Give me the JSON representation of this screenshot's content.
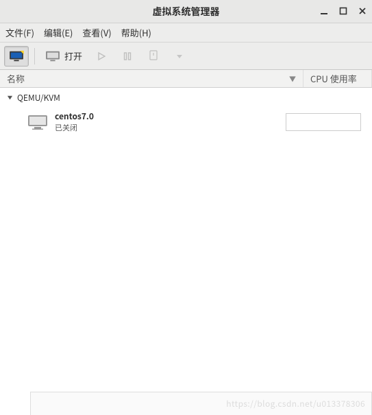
{
  "window": {
    "title": "虚拟系统管理器"
  },
  "menu": {
    "file": "文件(F)",
    "edit": "编辑(E)",
    "view": "查看(V)",
    "help": "帮助(H)"
  },
  "toolbar": {
    "open_label": "打开"
  },
  "columns": {
    "name": "名称",
    "cpu": "CPU 使用率"
  },
  "connections": [
    {
      "name": "QEMU/KVM",
      "vms": [
        {
          "name": "centos7.0",
          "status": "已关闭"
        }
      ]
    }
  ],
  "watermark": "https://blog.csdn.net/u013378306"
}
